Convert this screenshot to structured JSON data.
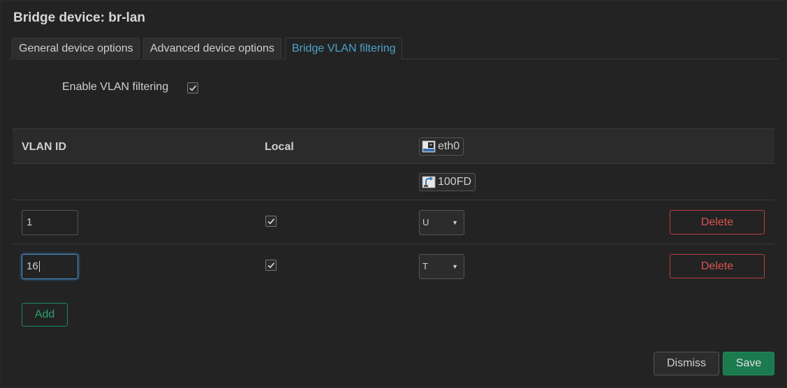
{
  "dialog": {
    "title": "Bridge device: br-lan"
  },
  "tabs": [
    {
      "label": "General device options",
      "active": false
    },
    {
      "label": "Advanced device options",
      "active": false
    },
    {
      "label": "Bridge VLAN filtering",
      "active": true
    }
  ],
  "vlan_filtering": {
    "label": "Enable VLAN filtering",
    "checked": true
  },
  "table": {
    "headers": {
      "vlan_id": "VLAN ID",
      "local": "Local"
    },
    "port": {
      "name": "eth0",
      "speed": "100FD",
      "name_icon": "ethernet-port-icon",
      "speed_icon": "link-speed-icon"
    },
    "rows": [
      {
        "vlan_id": "1",
        "local": true,
        "tag": "U",
        "delete_label": "Delete"
      },
      {
        "vlan_id": "16",
        "local": true,
        "tag": "T",
        "delete_label": "Delete"
      }
    ]
  },
  "buttons": {
    "add": "Add",
    "dismiss": "Dismiss",
    "save": "Save"
  },
  "colors": {
    "accent": "#4aa3c9",
    "delete": "#d9544f",
    "positive": "#1c7a4f"
  }
}
